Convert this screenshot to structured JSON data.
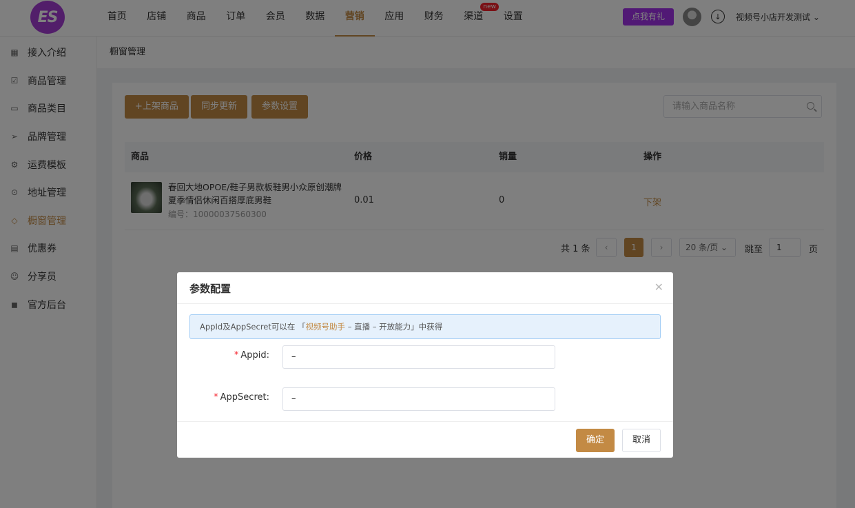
{
  "topbar": {
    "logo_text": "ES",
    "nav": [
      {
        "label": "首页",
        "active": false
      },
      {
        "label": "店铺",
        "active": false
      },
      {
        "label": "商品",
        "active": false
      },
      {
        "label": "订单",
        "active": false
      },
      {
        "label": "会员",
        "active": false
      },
      {
        "label": "数据",
        "active": false
      },
      {
        "label": "营销",
        "active": true
      },
      {
        "label": "应用",
        "active": false
      },
      {
        "label": "财务",
        "active": false
      },
      {
        "label": "渠道",
        "active": false,
        "badge": "new"
      },
      {
        "label": "设置",
        "active": false
      }
    ],
    "promo_label": "点我有礼",
    "shop_name": "视频号小店开发测试",
    "accent_color": "#c38a44",
    "promo_color": "#a233ea"
  },
  "sidebar": {
    "items": [
      {
        "label": "接入介绍",
        "icon": "grid-icon",
        "active": false
      },
      {
        "label": "商品管理",
        "icon": "checklist-icon",
        "active": false
      },
      {
        "label": "商品类目",
        "icon": "folder-icon",
        "active": false
      },
      {
        "label": "品牌管理",
        "icon": "paper-plane-icon",
        "active": false
      },
      {
        "label": "运费模板",
        "icon": "gear-icon",
        "active": false
      },
      {
        "label": "地址管理",
        "icon": "location-pin-icon",
        "active": false
      },
      {
        "label": "橱窗管理",
        "icon": "tag-icon",
        "active": true
      },
      {
        "label": "优惠券",
        "icon": "ticket-icon",
        "active": false
      },
      {
        "label": "分享员",
        "icon": "users-icon",
        "active": false
      },
      {
        "label": "官方后台",
        "icon": "shop-bag-icon",
        "active": false
      }
    ]
  },
  "page": {
    "title": "橱窗管理",
    "buttons": {
      "add": "+上架商品",
      "sync": "同步更新",
      "settings": "参数设置"
    },
    "search_placeholder": "请输入商品名称",
    "table": {
      "headers": [
        "商品",
        "价格",
        "销量",
        "操作"
      ],
      "rows": [
        {
          "name": "春回大地OPOE/鞋子男款板鞋男小众原创潮牌夏季情侣休闲百搭厚底男鞋",
          "sku": "编号：10000037560300",
          "price": "0.01",
          "sales": "0",
          "action": "下架"
        }
      ]
    },
    "pagination": {
      "total": "共 1 条",
      "prev": "‹",
      "current": "1",
      "next": "›",
      "page_size": "20 条/页",
      "jump_label": "跳至",
      "jump_value": "1",
      "page_unit": "页"
    }
  },
  "modal": {
    "title": "参数配置",
    "notice_prefix": "AppId及AppSecret可以在 「",
    "notice_link": "视频号助手",
    "notice_suffix": " – 直播 – 开放能力」中获得",
    "fields": [
      {
        "label": "Appid:",
        "value": "–"
      },
      {
        "label": "AppSecret:",
        "value": "–"
      }
    ],
    "confirm": "确定",
    "cancel": "取消"
  }
}
